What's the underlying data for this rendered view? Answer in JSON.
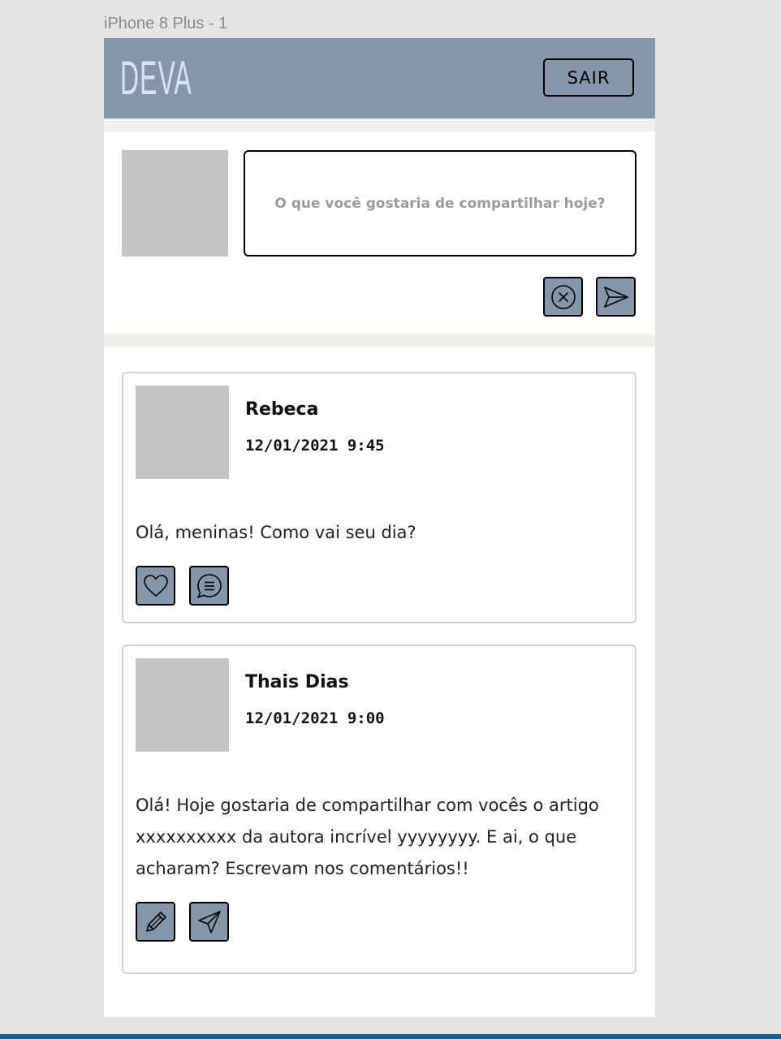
{
  "artboard": {
    "label": "iPhone 8 Plus - 1"
  },
  "header": {
    "logo": "DEVA",
    "logout_label": "SAIR",
    "colors": {
      "bar": "#8595aa",
      "logo": "#d9e4f2"
    }
  },
  "composer": {
    "placeholder": "O que você gostaria de compartilhar hoje?",
    "actions": [
      "close-circle-icon",
      "send-icon"
    ]
  },
  "posts": [
    {
      "author": "Rebeca",
      "timestamp": "12/01/2021 9:45",
      "text": "Olá, meninas! Como vai seu dia?",
      "actions": [
        "heart-icon",
        "comment-icon"
      ]
    },
    {
      "author": "Thais Dias",
      "timestamp": "12/01/2021 9:00",
      "text": "Olá! Hoje gostaria de compartilhar com vocês o artigo xxxxxxxxxx da autora incrível yyyyyyyy. E ai, o que acharam? Escrevam nos comentários!!",
      "actions": [
        "pencil-icon",
        "share-send-icon"
      ]
    }
  ]
}
